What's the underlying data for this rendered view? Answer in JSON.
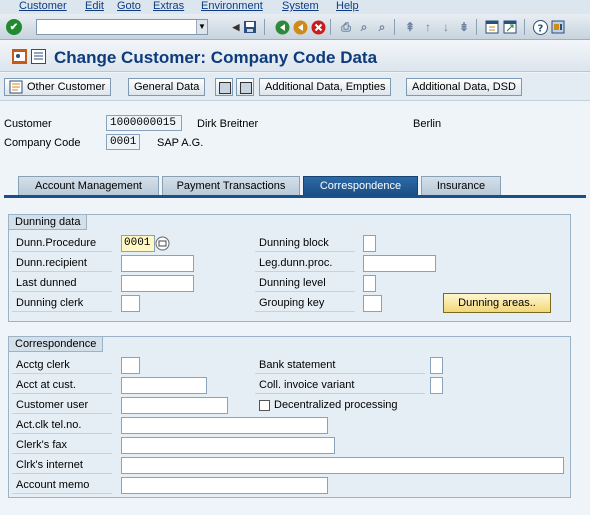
{
  "menu": {
    "items": [
      "Customer",
      "Edit",
      "Goto",
      "Extras",
      "Environment",
      "System",
      "Help"
    ]
  },
  "toolbar": {
    "command_field_value": ""
  },
  "title": "Change Customer: Company Code Data",
  "app_toolbar": {
    "other_customer": "Other Customer",
    "general_data": "General Data",
    "additional_empties": "Additional Data, Empties",
    "additional_dsd": "Additional Data, DSD"
  },
  "header": {
    "customer_label": "Customer",
    "customer_value": "1000000015",
    "customer_name": "Dirk Breitner",
    "customer_city": "Berlin",
    "company_code_label": "Company Code",
    "company_code_value": "0001",
    "company_name": "SAP A.G."
  },
  "tabs": [
    {
      "label": "Account Management",
      "active": false
    },
    {
      "label": "Payment Transactions",
      "active": false
    },
    {
      "label": "Correspondence",
      "active": true
    },
    {
      "label": "Insurance",
      "active": false
    }
  ],
  "dunning": {
    "title": "Dunning data",
    "procedure_label": "Dunn.Procedure",
    "procedure_value": "0001",
    "recipient_label": "Dunn.recipient",
    "recipient_value": "",
    "last_dunned_label": "Last dunned",
    "last_dunned_value": "",
    "clerk_label": "Dunning clerk",
    "clerk_value": "",
    "block_label": "Dunning block",
    "block_value": "",
    "legal_label": "Leg.dunn.proc.",
    "legal_value": "",
    "level_label": "Dunning level",
    "level_value": "",
    "grouping_label": "Grouping key",
    "grouping_value": "",
    "areas_button": "Dunning areas.."
  },
  "correspondence": {
    "title": "Correspondence",
    "acctg_clerk_label": "Acctg clerk",
    "acct_at_cust_label": "Acct at cust.",
    "customer_user_label": "Customer user",
    "tel_label": "Act.clk tel.no.",
    "fax_label": "Clerk's fax",
    "internet_label": "Clrk's internet",
    "memo_label": "Account memo",
    "bank_statement_label": "Bank statement",
    "coll_invoice_label": "Coll. invoice variant",
    "decentralized_label": "Decentralized processing",
    "decentralized_checked": false
  },
  "colors": {
    "title": "#0d3b7c",
    "active_tab": "#1b4f86",
    "button": "#f2d77a"
  }
}
